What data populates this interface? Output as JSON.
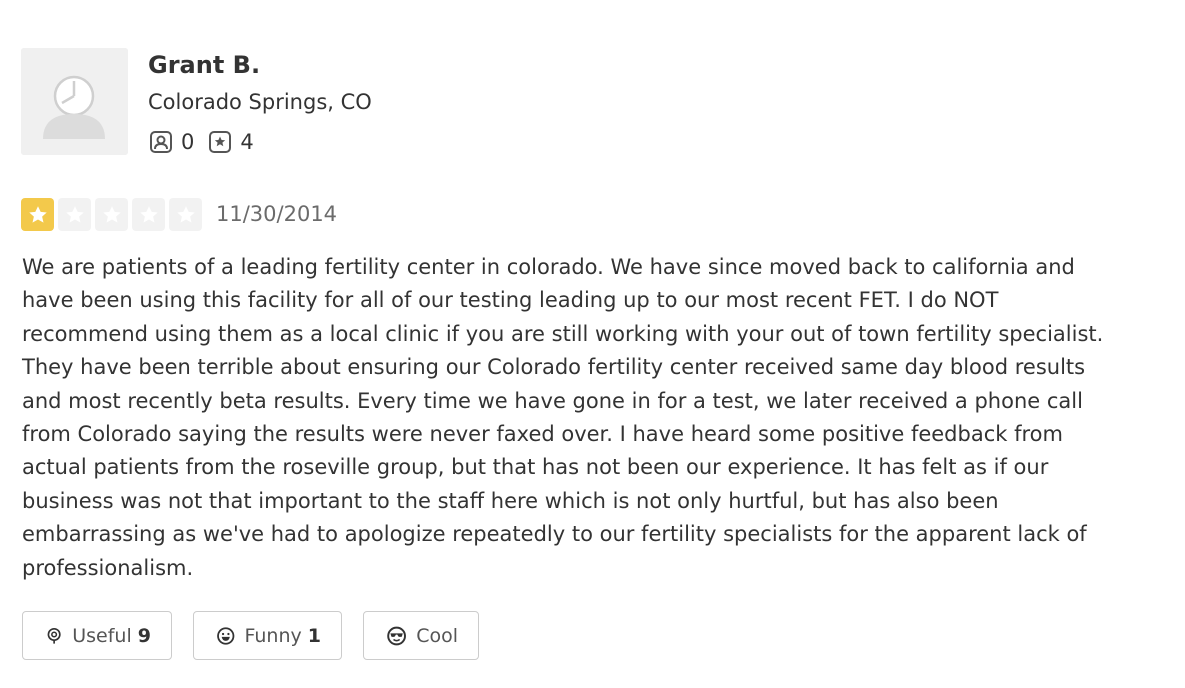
{
  "user": {
    "name": "Grant B.",
    "location": "Colorado Springs, CO",
    "friends_count": "0",
    "reviews_count": "4",
    "avatar_icon": "default-user-avatar-icon"
  },
  "review": {
    "rating": 1,
    "rating_max": 5,
    "date": "11/30/2014",
    "text": "We are patients of a leading fertility center in colorado. We have since moved back to california and have been using this facility for all of our testing leading up to our most recent FET. I do NOT recommend using them as a local clinic if you are still working with your out of town fertility specialist. They have been terrible about ensuring our Colorado fertility center received same day blood results and most recently beta results. Every time we have gone in for a test, we later received a phone call from Colorado saying the results were never faxed over. I have heard some positive feedback from actual patients from the roseville group, but that has not been our experience. It has felt as if our business was not that important to the staff here which is not only hurtful, but has also been embarrassing as we've had to apologize repeatedly to our fertility specialists for the apparent lack of professionalism."
  },
  "actions": {
    "useful": {
      "label": "Useful",
      "count": "9",
      "icon": "lightbulb-icon"
    },
    "funny": {
      "label": "Funny",
      "count": "1",
      "icon": "smiley-icon"
    },
    "cool": {
      "label": "Cool",
      "icon": "sunglasses-face-icon"
    }
  },
  "colors": {
    "star_filled": "#f3c94b",
    "star_empty": "#f2f2f2",
    "text": "#333333",
    "border": "#cccccc"
  }
}
